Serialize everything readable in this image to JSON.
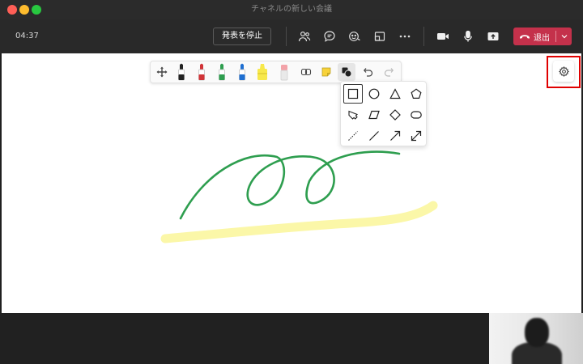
{
  "window": {
    "title": "チャネルの新しい会議"
  },
  "meeting": {
    "timer": "04:37",
    "stop_presenting_label": "発表を停止",
    "leave_label": "退出",
    "icons": [
      "people-icon",
      "chat-icon",
      "reactions-icon",
      "rooms-icon",
      "more-icon",
      "camera-icon",
      "mic-icon",
      "share-icon"
    ]
  },
  "whiteboard": {
    "pen_toolbar": {
      "tools": [
        "move-tool",
        "black-pen",
        "red-pen",
        "green-pen",
        "blue-pen",
        "yellow-highlighter",
        "eraser",
        "lasso",
        "sticky-note",
        "shapes",
        "undo",
        "redo"
      ],
      "pen_colors": {
        "black": "#222222",
        "red": "#d13438",
        "green": "#2e9e4f",
        "blue": "#1f6fd1",
        "highlighter": "#f7e84a",
        "eraser": "#f3a3a9"
      },
      "active_tool": "shapes"
    },
    "shape_panel": {
      "shapes": [
        "square",
        "circle",
        "triangle",
        "pentagon",
        "arrow-block",
        "parallelogram",
        "diamond",
        "rounded-rectangle",
        "dashed-line",
        "line",
        "arrow",
        "double-arrow"
      ],
      "selected_shape": "square"
    },
    "ink_colors": {
      "green_stroke": "#2e9e4f",
      "highlight_stroke": "#fbf7a8"
    }
  },
  "colors": {
    "accent_leave": "#c4314b",
    "highlight_frame": "#e00000"
  }
}
